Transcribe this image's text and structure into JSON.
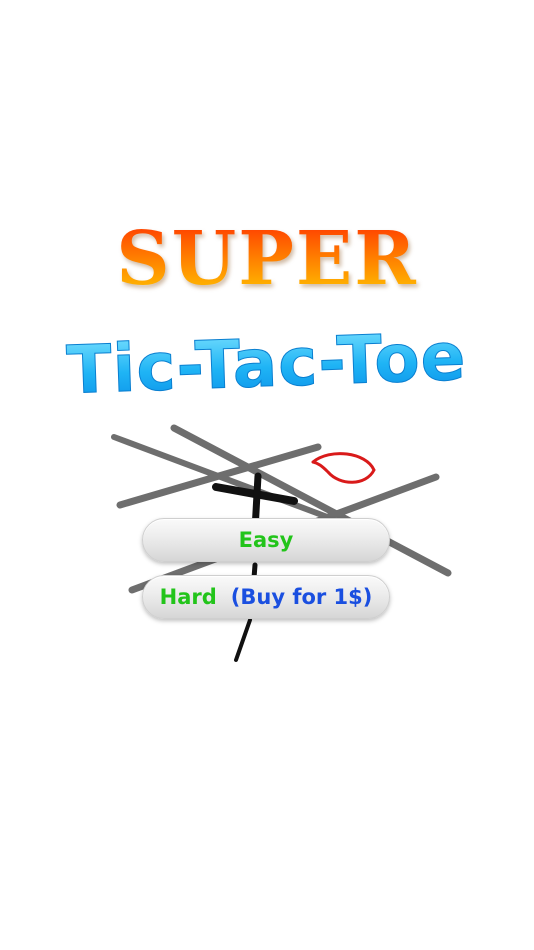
{
  "title": {
    "line1": "SUPER",
    "line2": "Tic-Tac-Toe"
  },
  "menu": {
    "easy_label": "Easy",
    "hard_label": "Hard",
    "hard_price": "(Buy for 1$)"
  },
  "colors": {
    "background": "#ffffff",
    "super_gradient_top": "#ff3a00",
    "super_gradient_bottom": "#ffc300",
    "ttt_blue_light": "#7fe3ff",
    "ttt_blue_dark": "#0a8fe8",
    "easy_text": "#22c41a",
    "hard_text": "#22c41a",
    "price_text": "#1a4fe0",
    "board_lines": "#6e6e6e",
    "x_mark": "#111111",
    "o_mark": "#d91a1a"
  },
  "icons": {
    "board": "tic-tac-toe-board-sketch",
    "x": "x-mark",
    "o": "o-mark"
  }
}
